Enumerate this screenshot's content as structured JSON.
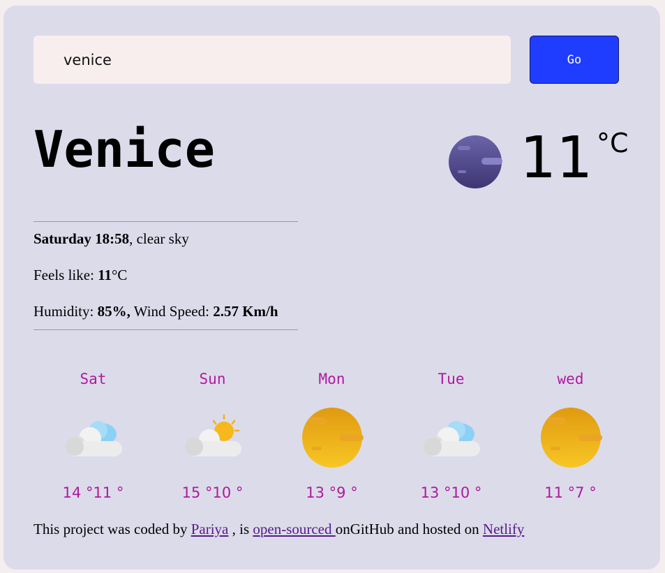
{
  "search": {
    "value": "venice",
    "button_label": "Go"
  },
  "current": {
    "city": "Venice",
    "temperature": "11",
    "unit": "°C",
    "icon": "night-clear-icon"
  },
  "details": {
    "day_time": "Saturday 18:58",
    "description": ", clear sky",
    "feels_label": "Feels like: ",
    "feels_value": "11",
    "feels_unit": "°C",
    "humidity_label": "Humidity: ",
    "humidity_value": "85%,",
    "wind_label": " Wind Speed: ",
    "wind_value": "2.57 Km/h"
  },
  "forecast": [
    {
      "day": "Sat",
      "temps": "14 °11 °",
      "icon": "cloud-icon"
    },
    {
      "day": "Sun",
      "temps": "15 °10 °",
      "icon": "partly-sunny-icon"
    },
    {
      "day": "Mon",
      "temps": "13 °9 °",
      "icon": "sun-icon"
    },
    {
      "day": "Tue",
      "temps": "13 °10 °",
      "icon": "cloud-icon"
    },
    {
      "day": "wed",
      "temps": "11 °7 °",
      "icon": "sun-icon"
    }
  ],
  "footer": {
    "text1": "This project was coded by ",
    "author_link": "Pariya",
    "text2": " , is ",
    "source_link": "open-sourced ",
    "text3": "onGitHub and hosted on ",
    "host_link": "Netlify"
  },
  "colors": {
    "background": "#dcdbea",
    "accent": "#1f3dff",
    "forecast_text": "#b0199d"
  }
}
